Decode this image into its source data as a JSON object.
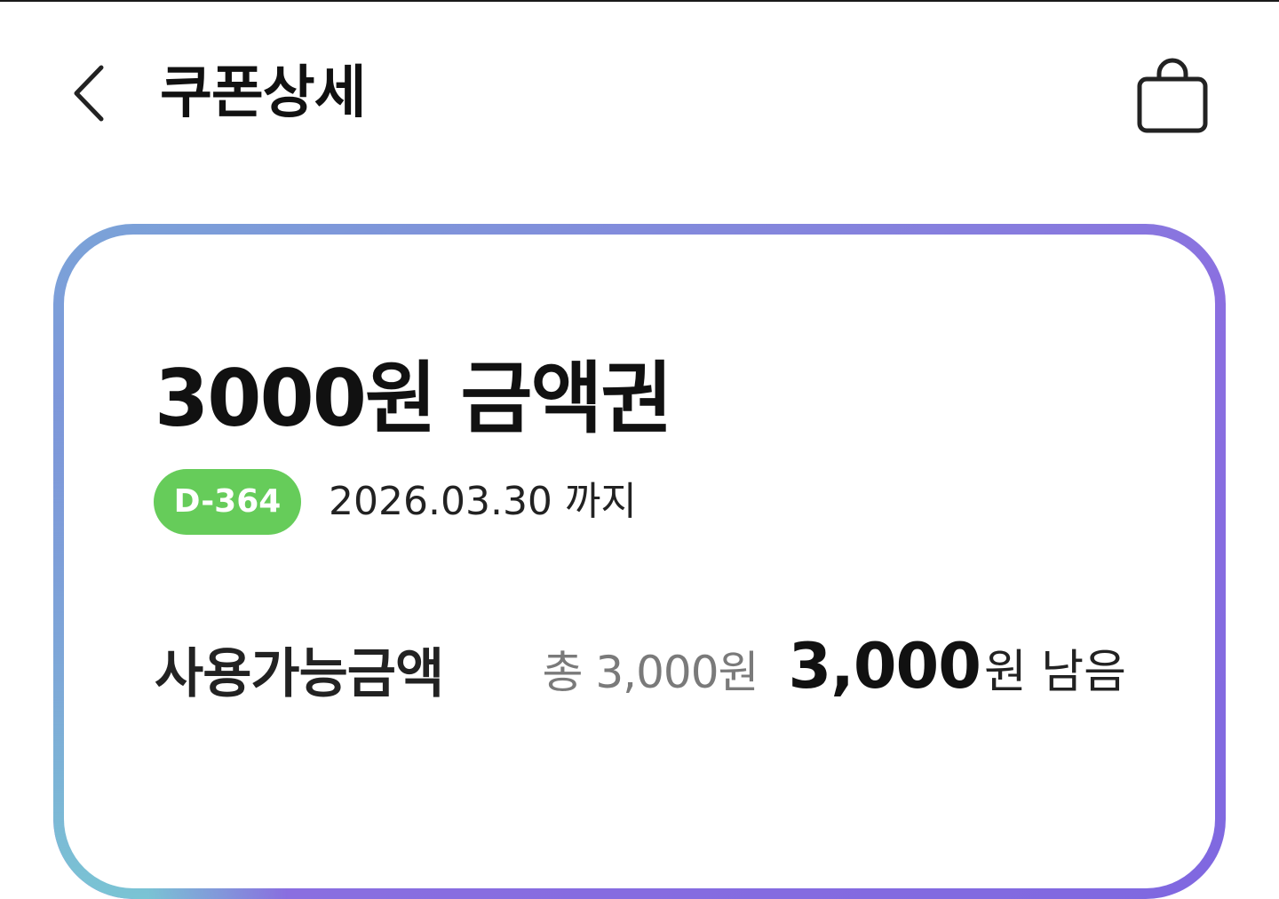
{
  "header": {
    "title": "쿠폰상세",
    "back_icon": "chevron-left-icon",
    "cart_icon": "shopping-bag-icon"
  },
  "coupon": {
    "name": "3000원 금액권",
    "dday": "D-364",
    "expiry": "2026.03.30 까지",
    "available_label": "사용가능금액",
    "total_text": "총 3,000원",
    "remaining_value": "3,000",
    "remaining_unit": "원 남음"
  },
  "colors": {
    "badge_green": "#66cc5a",
    "gradient_start": "#7aa4d8",
    "gradient_end": "#8b6fe0",
    "gradient_teal": "#78cdd2"
  }
}
